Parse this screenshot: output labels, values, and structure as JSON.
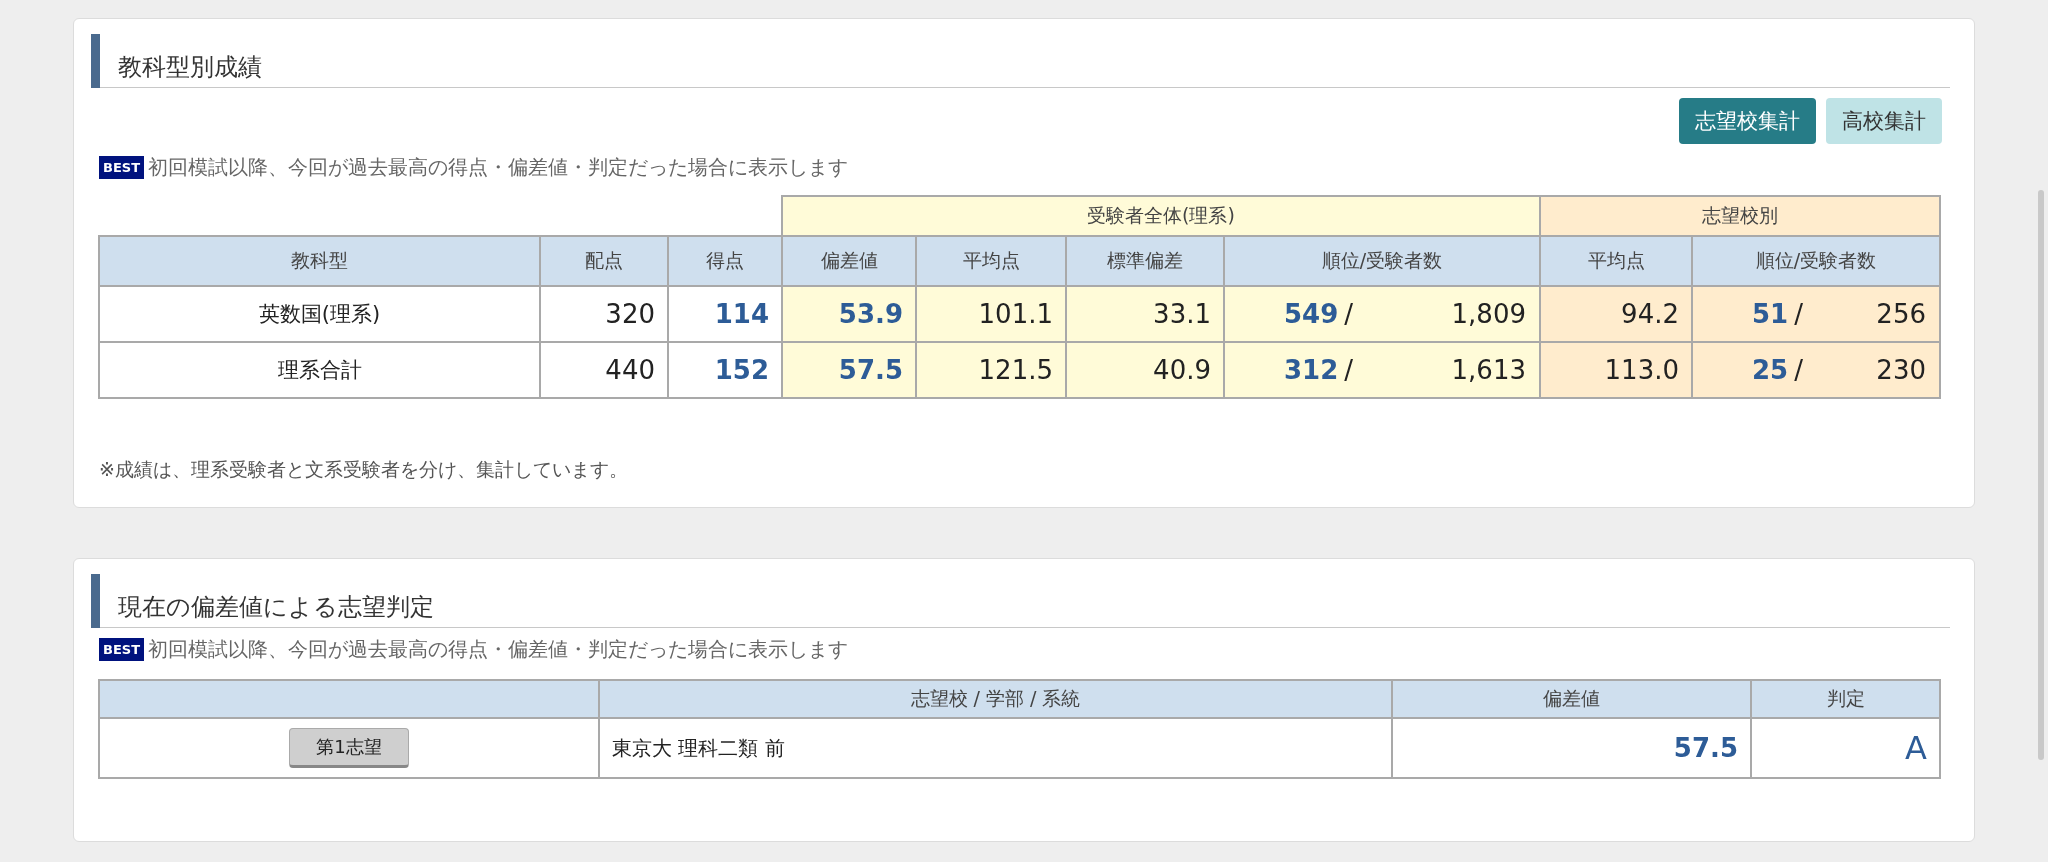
{
  "subject_results": {
    "title": "教科型別成績",
    "toggle_buttons": [
      {
        "label": "志望校集計",
        "selected": true
      },
      {
        "label": "高校集計",
        "selected": false
      }
    ],
    "best_note": {
      "badge": "BEST",
      "text": "初回模試以降、今回が過去最高の得点・偏差値・判定だった場合に表示します"
    },
    "group_headers": [
      "受験者全体(理系)",
      "志望校別"
    ],
    "columns": [
      "教科型",
      "配点",
      "得点",
      "偏差値",
      "平均点",
      "標準偏差",
      "順位/受験者数",
      "平均点",
      "順位/受験者数"
    ],
    "rows": [
      {
        "subject": "英数国(理系)",
        "max_score": "320",
        "score": "114",
        "deviation": "53.9",
        "average": "101.1",
        "std_dev": "33.1",
        "rank": "549",
        "rank_sep": "/",
        "examinees": "1,809",
        "school_average": "94.2",
        "school_rank": "51",
        "school_rank_sep": "/",
        "school_examinees": "256"
      },
      {
        "subject": "理系合計",
        "max_score": "440",
        "score": "152",
        "deviation": "57.5",
        "average": "121.5",
        "std_dev": "40.9",
        "rank": "312",
        "rank_sep": "/",
        "examinees": "1,613",
        "school_average": "113.0",
        "school_rank": "25",
        "school_rank_sep": "/",
        "school_examinees": "230"
      }
    ],
    "footnote": "※成績は、理系受験者と文系受験者を分け、集計しています。"
  },
  "judgement": {
    "title": "現在の偏差値による志望判定",
    "best_note": {
      "badge": "BEST",
      "text": "初回模試以降、今回が過去最高の得点・偏差値・判定だった場合に表示します"
    },
    "columns": [
      "志望校 / 学部 / 系統",
      "偏差値",
      "判定"
    ],
    "rows": [
      {
        "choice": "第1志望",
        "school": "東京大 理科二類 前",
        "deviation": "57.5",
        "grade": "A"
      }
    ]
  }
}
